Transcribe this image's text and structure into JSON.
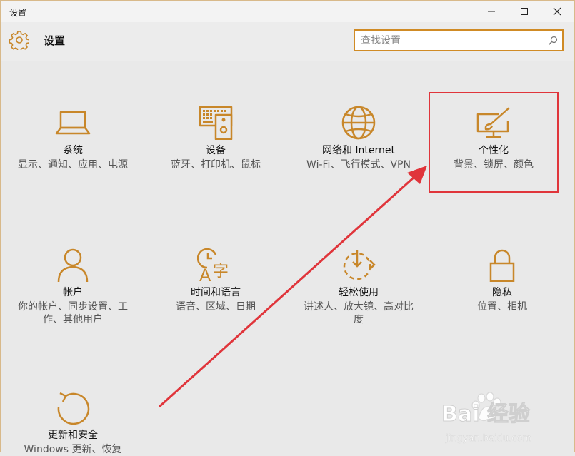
{
  "window": {
    "title": "设置"
  },
  "header": {
    "title": "设置",
    "search_placeholder": "查找设置"
  },
  "tiles": [
    {
      "name": "系统",
      "desc": "显示、通知、应用、电源"
    },
    {
      "name": "设备",
      "desc": "蓝牙、打印机、鼠标"
    },
    {
      "name": "网络和 Internet",
      "desc": "Wi-Fi、飞行模式、VPN"
    },
    {
      "name": "个性化",
      "desc": "背景、锁屏、颜色"
    },
    {
      "name": "帐户",
      "desc": "你的帐户、同步设置、工作、其他用户"
    },
    {
      "name": "时间和语言",
      "desc": "语音、区域、日期"
    },
    {
      "name": "轻松使用",
      "desc": "讲述人、放大镜、高对比度"
    },
    {
      "name": "隐私",
      "desc": "位置、相机"
    },
    {
      "name": "更新和安全",
      "desc": "Windows 更新、恢复"
    }
  ],
  "watermark": {
    "brand": "Bai  经验",
    "url": "jingyan.baidu.com"
  },
  "colors": {
    "accent": "#c8872a",
    "annotation": "#e0353b"
  }
}
